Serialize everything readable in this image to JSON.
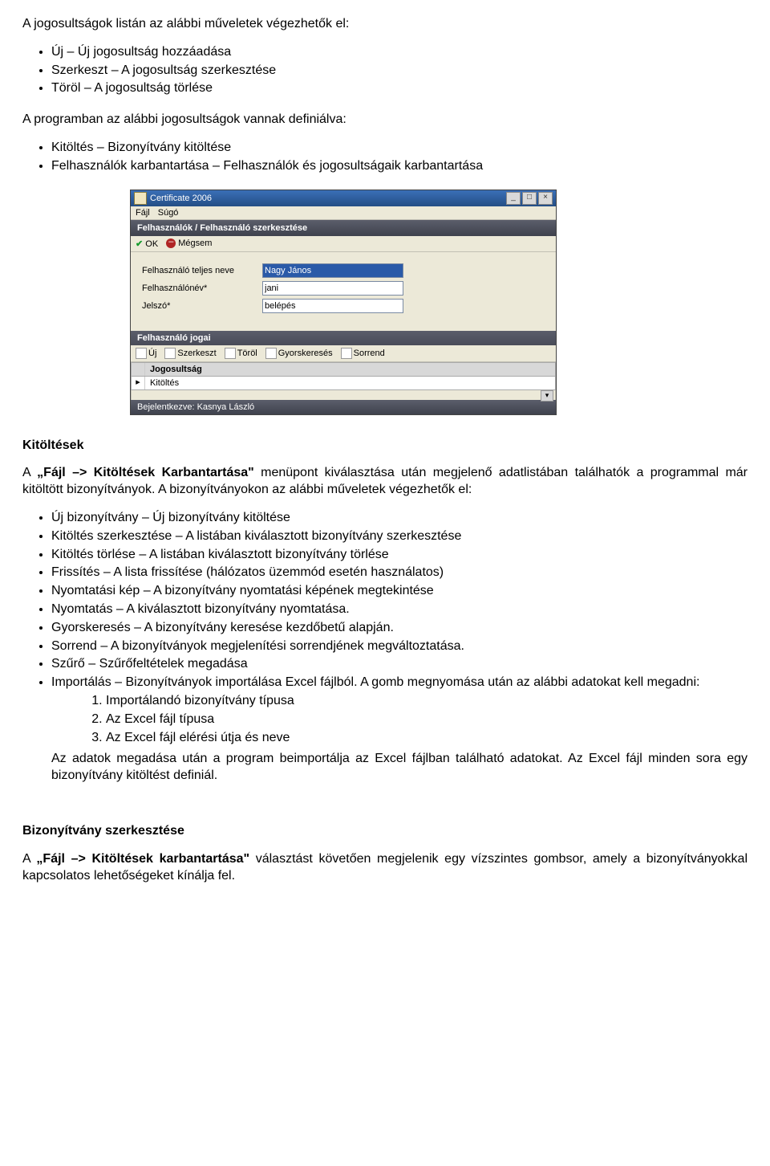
{
  "intro": {
    "line1": "A jogosultságok listán az alábbi műveletek végezhetők el:",
    "ops": [
      "Új – Új jogosultság hozzáadása",
      "Szerkeszt – A jogosultság szerkesztése",
      "Töröl – A jogosultság törlése"
    ],
    "para2": "A programban az alábbi jogosultságok vannak definiálva:",
    "defs": [
      "Kitöltés – Bizonyítvány kitöltése",
      "Felhasználók karbantartása – Felhasználók és jogosultságaik karbantartása"
    ]
  },
  "app": {
    "title": "Certificate 2006",
    "menu": {
      "fajl": "Fájl",
      "sugo": "Súgó"
    },
    "panel_header": "Felhasználók / Felhasználó szerkesztése",
    "tb": {
      "ok": "OK",
      "megsem": "Mégsem"
    },
    "form": {
      "nev_label": "Felhasználó teljes neve",
      "nev_val": "Nagy János",
      "user_label": "Felhasználónév*",
      "user_val": "jani",
      "pw_label": "Jelszó*",
      "pw_val": "belépés"
    },
    "sub_header": "Felhasználó jogai",
    "subtb": {
      "uj": "Új",
      "szerk": "Szerkeszt",
      "torol": "Töröl",
      "gyors": "Gyorskeresés",
      "sorrend": "Sorrend"
    },
    "grid": {
      "header": "Jogosultság",
      "row1": "Kitöltés"
    },
    "status": "Bejelentkezve: Kasnya László"
  },
  "kitoltesek": {
    "heading": "Kitöltések",
    "para_a": "A ",
    "para_b": "„Fájl –> Kitöltések Karbantartása\"",
    "para_c": " menüpont kiválasztása után megjelenő adatlistában találhatók a programmal már kitöltött bizonyítványok. A bizonyítványokon az alábbi műveletek végezhetők el:",
    "items": [
      "Új bizonyítvány – Új bizonyítvány kitöltése",
      "Kitöltés szerkesztése – A listában kiválasztott bizonyítvány szerkesztése",
      "Kitöltés törlése – A listában kiválasztott bizonyítvány törlése",
      "Frissítés – A lista frissítése (hálózatos üzemmód esetén használatos)",
      "Nyomtatási kép – A bizonyítvány nyomtatási képének megtekintése",
      "Nyomtatás – A kiválasztott bizonyítvány nyomtatása.",
      "Gyorskeresés – A bizonyítvány keresése kezdőbetű alapján.",
      "Sorrend – A bizonyítványok megjelenítési sorrendjének megváltoztatása.",
      "Szűrő – Szűrőfeltételek megadása"
    ],
    "import_item": "Importálás – Bizonyítványok importálása Excel fájlból. A gomb megnyomása után az alábbi adatokat kell megadni:",
    "import_sub": [
      "Importálandó bizonyítvány típusa",
      "Az Excel fájl típusa",
      "Az Excel fájl elérési útja és neve"
    ],
    "import_after": "Az adatok megadása után a program beimportálja az Excel fájlban található adatokat. Az Excel fájl minden sora egy bizonyítvány kitöltést definiál."
  },
  "biz": {
    "heading": "Bizonyítvány szerkesztése",
    "para_a": "A ",
    "para_b": "„Fájl –> Kitöltések karbantartása\"",
    "para_c": " választást követően megjelenik egy vízszintes gombsor, amely a bizonyítványokkal kapcsolatos lehetőségeket kínálja fel."
  }
}
